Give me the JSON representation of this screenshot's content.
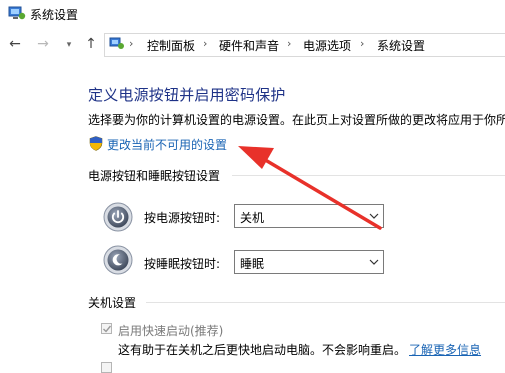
{
  "window": {
    "title": "系统设置"
  },
  "breadcrumb": [
    "控制面板",
    "硬件和声音",
    "电源选项",
    "系统设置"
  ],
  "page": {
    "heading": "定义电源按钮并启用密码保护",
    "description": "选择要为你的计算机设置的电源设置。在此页上对设置所做的更改将应用于你所",
    "change_link": "更改当前不可用的设置"
  },
  "power_section": {
    "title": "电源按钮和睡眠按钮设置",
    "rows": [
      {
        "label": "按电源按钮时:",
        "value": "关机",
        "icon": "power-button-icon"
      },
      {
        "label": "按睡眠按钮时:",
        "value": "睡眠",
        "icon": "sleep-button-icon"
      }
    ]
  },
  "shutdown_section": {
    "title": "关机设置",
    "fast_startup_label": "启用快速启动(推荐)",
    "fast_startup_checked": true,
    "fast_startup_desc": "这有助于在关机之后更快地启动电脑。不会影响重启。",
    "learn_more": "了解更多信息"
  },
  "colors": {
    "heading": "#1e3287",
    "link": "#1a64b4",
    "annotation_arrow": "#e8312a"
  }
}
